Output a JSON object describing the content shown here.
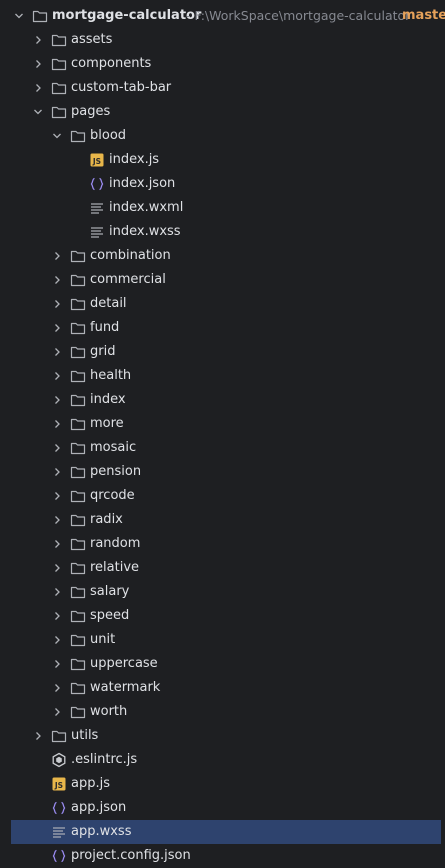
{
  "root": {
    "name": "mortgage-calculator",
    "path": "- F:\\WorkSpace\\mortgage-calculator",
    "branch": "master"
  },
  "items": [
    {
      "label": "assets",
      "type": "folder",
      "level": 1,
      "state": "collapsed"
    },
    {
      "label": "components",
      "type": "folder",
      "level": 1,
      "state": "collapsed"
    },
    {
      "label": "custom-tab-bar",
      "type": "folder",
      "level": 1,
      "state": "collapsed"
    },
    {
      "label": "pages",
      "type": "folder",
      "level": 1,
      "state": "expanded"
    },
    {
      "label": "blood",
      "type": "folder",
      "level": 2,
      "state": "expanded"
    },
    {
      "label": "index.js",
      "type": "js",
      "level": 3
    },
    {
      "label": "index.json",
      "type": "json",
      "level": 3
    },
    {
      "label": "index.wxml",
      "type": "text",
      "level": 3
    },
    {
      "label": "index.wxss",
      "type": "text",
      "level": 3
    },
    {
      "label": "combination",
      "type": "folder",
      "level": 2,
      "state": "collapsed"
    },
    {
      "label": "commercial",
      "type": "folder",
      "level": 2,
      "state": "collapsed"
    },
    {
      "label": "detail",
      "type": "folder",
      "level": 2,
      "state": "collapsed"
    },
    {
      "label": "fund",
      "type": "folder",
      "level": 2,
      "state": "collapsed"
    },
    {
      "label": "grid",
      "type": "folder",
      "level": 2,
      "state": "collapsed"
    },
    {
      "label": "health",
      "type": "folder",
      "level": 2,
      "state": "collapsed"
    },
    {
      "label": "index",
      "type": "folder",
      "level": 2,
      "state": "collapsed"
    },
    {
      "label": "more",
      "type": "folder",
      "level": 2,
      "state": "collapsed"
    },
    {
      "label": "mosaic",
      "type": "folder",
      "level": 2,
      "state": "collapsed"
    },
    {
      "label": "pension",
      "type": "folder",
      "level": 2,
      "state": "collapsed"
    },
    {
      "label": "qrcode",
      "type": "folder",
      "level": 2,
      "state": "collapsed"
    },
    {
      "label": "radix",
      "type": "folder",
      "level": 2,
      "state": "collapsed"
    },
    {
      "label": "random",
      "type": "folder",
      "level": 2,
      "state": "collapsed"
    },
    {
      "label": "relative",
      "type": "folder",
      "level": 2,
      "state": "collapsed"
    },
    {
      "label": "salary",
      "type": "folder",
      "level": 2,
      "state": "collapsed"
    },
    {
      "label": "speed",
      "type": "folder",
      "level": 2,
      "state": "collapsed"
    },
    {
      "label": "unit",
      "type": "folder",
      "level": 2,
      "state": "collapsed"
    },
    {
      "label": "uppercase",
      "type": "folder",
      "level": 2,
      "state": "collapsed"
    },
    {
      "label": "watermark",
      "type": "folder",
      "level": 2,
      "state": "collapsed"
    },
    {
      "label": "worth",
      "type": "folder",
      "level": 2,
      "state": "collapsed"
    },
    {
      "label": "utils",
      "type": "folder",
      "level": 1,
      "state": "collapsed"
    },
    {
      "label": ".eslintrc.js",
      "type": "eslint",
      "level": 1
    },
    {
      "label": "app.js",
      "type": "js",
      "level": 1
    },
    {
      "label": "app.json",
      "type": "json",
      "level": 1
    },
    {
      "label": "app.wxss",
      "type": "text",
      "level": 1,
      "selected": true
    },
    {
      "label": "project.config.json",
      "type": "json",
      "level": 1
    }
  ],
  "colors": {
    "background": "#1e1f22",
    "text": "#dfe1e5",
    "muted": "#868991",
    "branch": "#e5a15a",
    "selection": "#2e436e",
    "js_badge": "#e8b64a",
    "json_brace": "#9b8cf2",
    "folder_stroke": "#aeb1b7"
  }
}
